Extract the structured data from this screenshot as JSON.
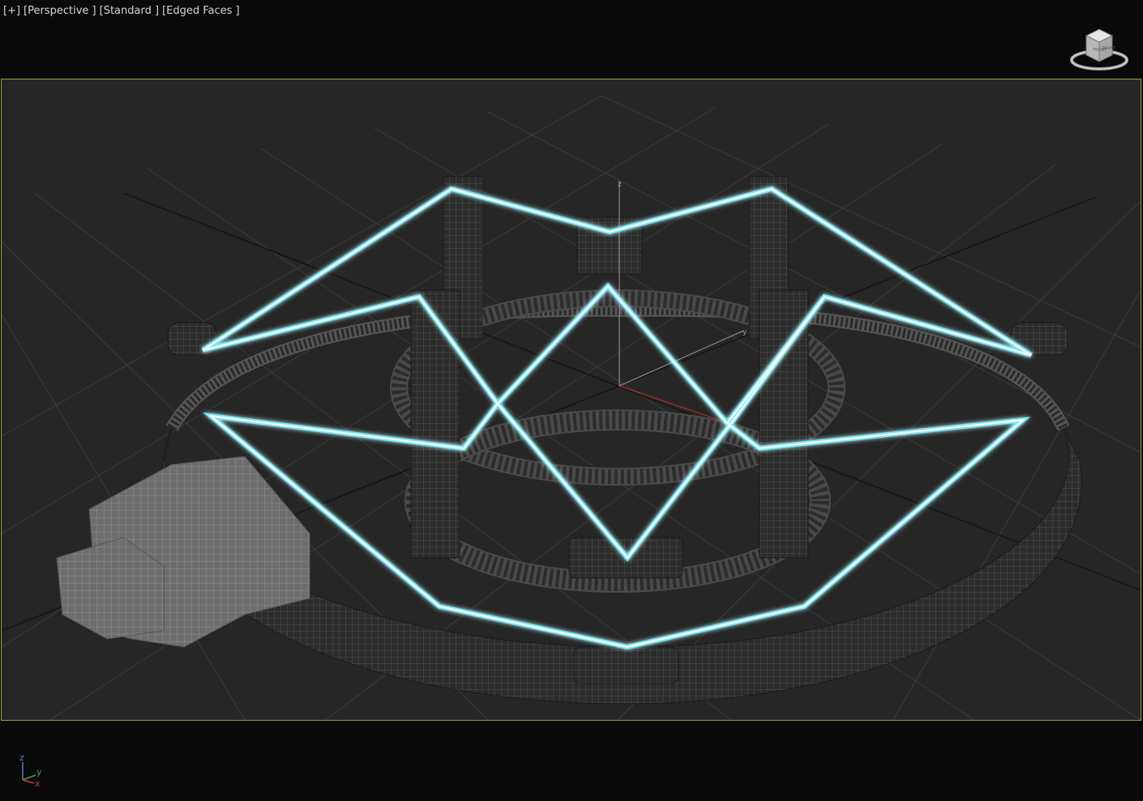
{
  "viewport": {
    "menu": {
      "plus": "[+]",
      "view": "[Perspective ]",
      "shading": "[Standard ]",
      "edges": "[Edged Faces ]"
    },
    "colors": {
      "background": "#0a0a0a",
      "grid": "#3a3a3a",
      "frame_border": "#a09a3a",
      "selection": "#7fe8f2",
      "mesh": "#4a4a4a",
      "mesh_light": "#8a8a8a"
    },
    "viewcube": {
      "icon": "viewcube-icon",
      "faces": [
        "FRONT",
        "RIGHT"
      ]
    },
    "tripod": {
      "x": "x",
      "y": "y",
      "z": "z"
    },
    "world_axis": {
      "y": "y",
      "z": "z"
    }
  }
}
